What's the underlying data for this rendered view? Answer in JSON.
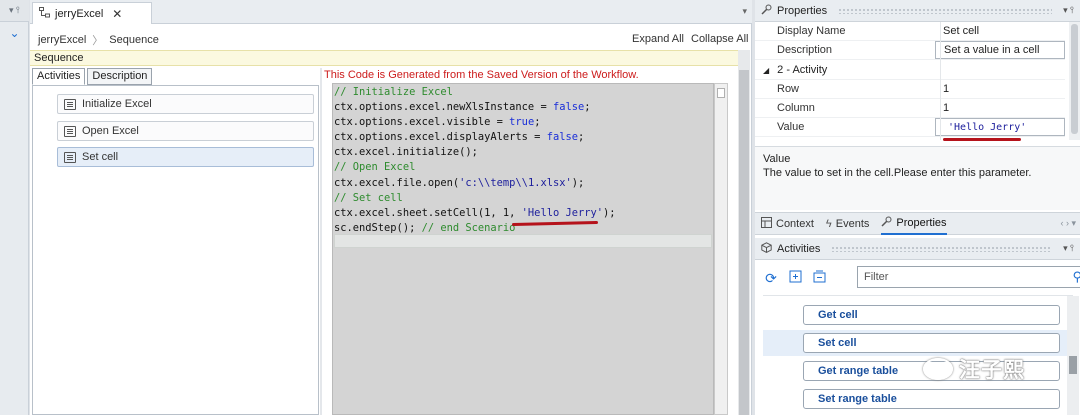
{
  "gutter": {
    "pin": "▾ ⫯",
    "chevron": "⌄"
  },
  "editor": {
    "tab_title": "jerryExcel",
    "tab_close": "✕",
    "tab_menu": "▾",
    "breadcrumb": [
      "jerryExcel",
      "Sequence"
    ],
    "breadcrumb_sep": "〉",
    "expand_all": "Expand All",
    "collapse_all": "Collapse All",
    "sequence_label": "Sequence",
    "pane_tabs": [
      "Activities",
      "Description"
    ],
    "activities": [
      "Initialize Excel",
      "Open Excel",
      "Set cell"
    ],
    "generated_notice": "This Code is Generated from the Saved Version of the Workflow.",
    "code": [
      [
        {
          "t": "// Initialize Excel",
          "c": "comment"
        }
      ],
      [
        {
          "t": "ctx.options.excel.newXlsInstance = ",
          "c": "plain"
        },
        {
          "t": "false",
          "c": "keyword"
        },
        {
          "t": ";",
          "c": "plain"
        }
      ],
      [
        {
          "t": "ctx.options.excel.visible = ",
          "c": "plain"
        },
        {
          "t": "true",
          "c": "keyword"
        },
        {
          "t": ";",
          "c": "plain"
        }
      ],
      [
        {
          "t": "ctx.options.excel.displayAlerts = ",
          "c": "plain"
        },
        {
          "t": "false",
          "c": "keyword"
        },
        {
          "t": ";",
          "c": "plain"
        }
      ],
      [
        {
          "t": "ctx.excel.initialize();",
          "c": "plain"
        }
      ],
      [
        {
          "t": "// Open Excel",
          "c": "comment"
        }
      ],
      [
        {
          "t": "ctx.excel.file.open(",
          "c": "plain"
        },
        {
          "t": "'c:\\\\temp\\\\1.xlsx'",
          "c": "string"
        },
        {
          "t": ");",
          "c": "plain"
        }
      ],
      [
        {
          "t": "// Set cell",
          "c": "comment"
        }
      ],
      [
        {
          "t": "ctx.excel.sheet.setCell(1, 1, ",
          "c": "plain"
        },
        {
          "t": "'Hello Jerry'",
          "c": "string"
        },
        {
          "t": ");",
          "c": "plain"
        }
      ],
      [
        {
          "t": "sc.endStep(); ",
          "c": "plain"
        },
        {
          "t": "// end Scenario",
          "c": "comment"
        }
      ]
    ]
  },
  "properties": {
    "title": "Properties",
    "rows": [
      {
        "key": "Display Name",
        "value": "Set cell"
      },
      {
        "key": "Description",
        "value": "Set a value in a cell"
      },
      {
        "key": "2 - Activity",
        "value": "",
        "category": true
      },
      {
        "key": "Row",
        "value": "1"
      },
      {
        "key": "Column",
        "value": "1"
      },
      {
        "key": "Value",
        "value": "'Hello Jerry'"
      }
    ],
    "category_toggle": "◢",
    "desc_title": "Value",
    "desc_text": "The value to set in the cell.Please enter this parameter."
  },
  "view_tabs": [
    "Context",
    "Events",
    "Properties"
  ],
  "view_tabs_ctrl": "‹ › ▾",
  "activities_panel": {
    "title": "Activities",
    "filter_placeholder": "Filter",
    "items": [
      "Get cell",
      "Set cell",
      "Get range table",
      "Set range table"
    ]
  },
  "watermark": "汪子熙",
  "colors": {
    "accent": "#1f6fd1",
    "notice_red": "#cc1b1b",
    "underline_red": "#b5121b",
    "code_bg": "#d4d4d4",
    "sequence_band": "#fbf9e0"
  }
}
